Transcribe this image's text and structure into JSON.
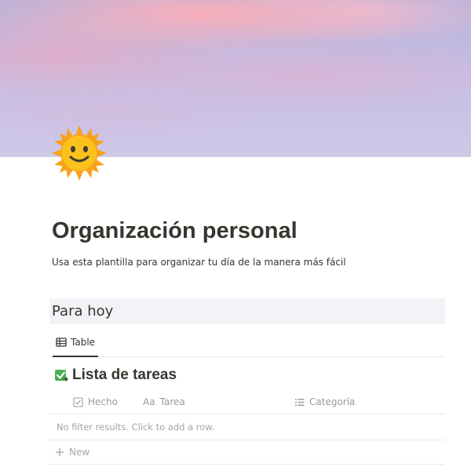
{
  "cover": {
    "description_colors": [
      "#fcafb9",
      "#c6bde2",
      "#b8b2da"
    ]
  },
  "page": {
    "icon": "sun-with-face-icon",
    "title": "Organización personal",
    "subtitle": "Usa esta plantilla para organizar tu día de la manera más fácil"
  },
  "section": {
    "heading": "Para hoy"
  },
  "view_tabs": [
    {
      "label": "Table",
      "icon": "table-icon",
      "active": true
    }
  ],
  "database": {
    "title": "Lista de tareas",
    "title_icon": "checkbox-checked-icon",
    "columns": [
      {
        "label": "Hecho",
        "icon": "checkbox-property-icon"
      },
      {
        "label": "Tarea",
        "icon": "Aa"
      },
      {
        "label": "Categoría",
        "icon": "list-property-icon"
      }
    ],
    "empty_message": "No filter results. Click to add a row.",
    "new_label": "New"
  },
  "colors": {
    "text": "#37352f",
    "muted": "#9b9a97",
    "section_bg": "#f4f2f7",
    "border": "#e9e9e7",
    "check_green": "#4caf50"
  }
}
